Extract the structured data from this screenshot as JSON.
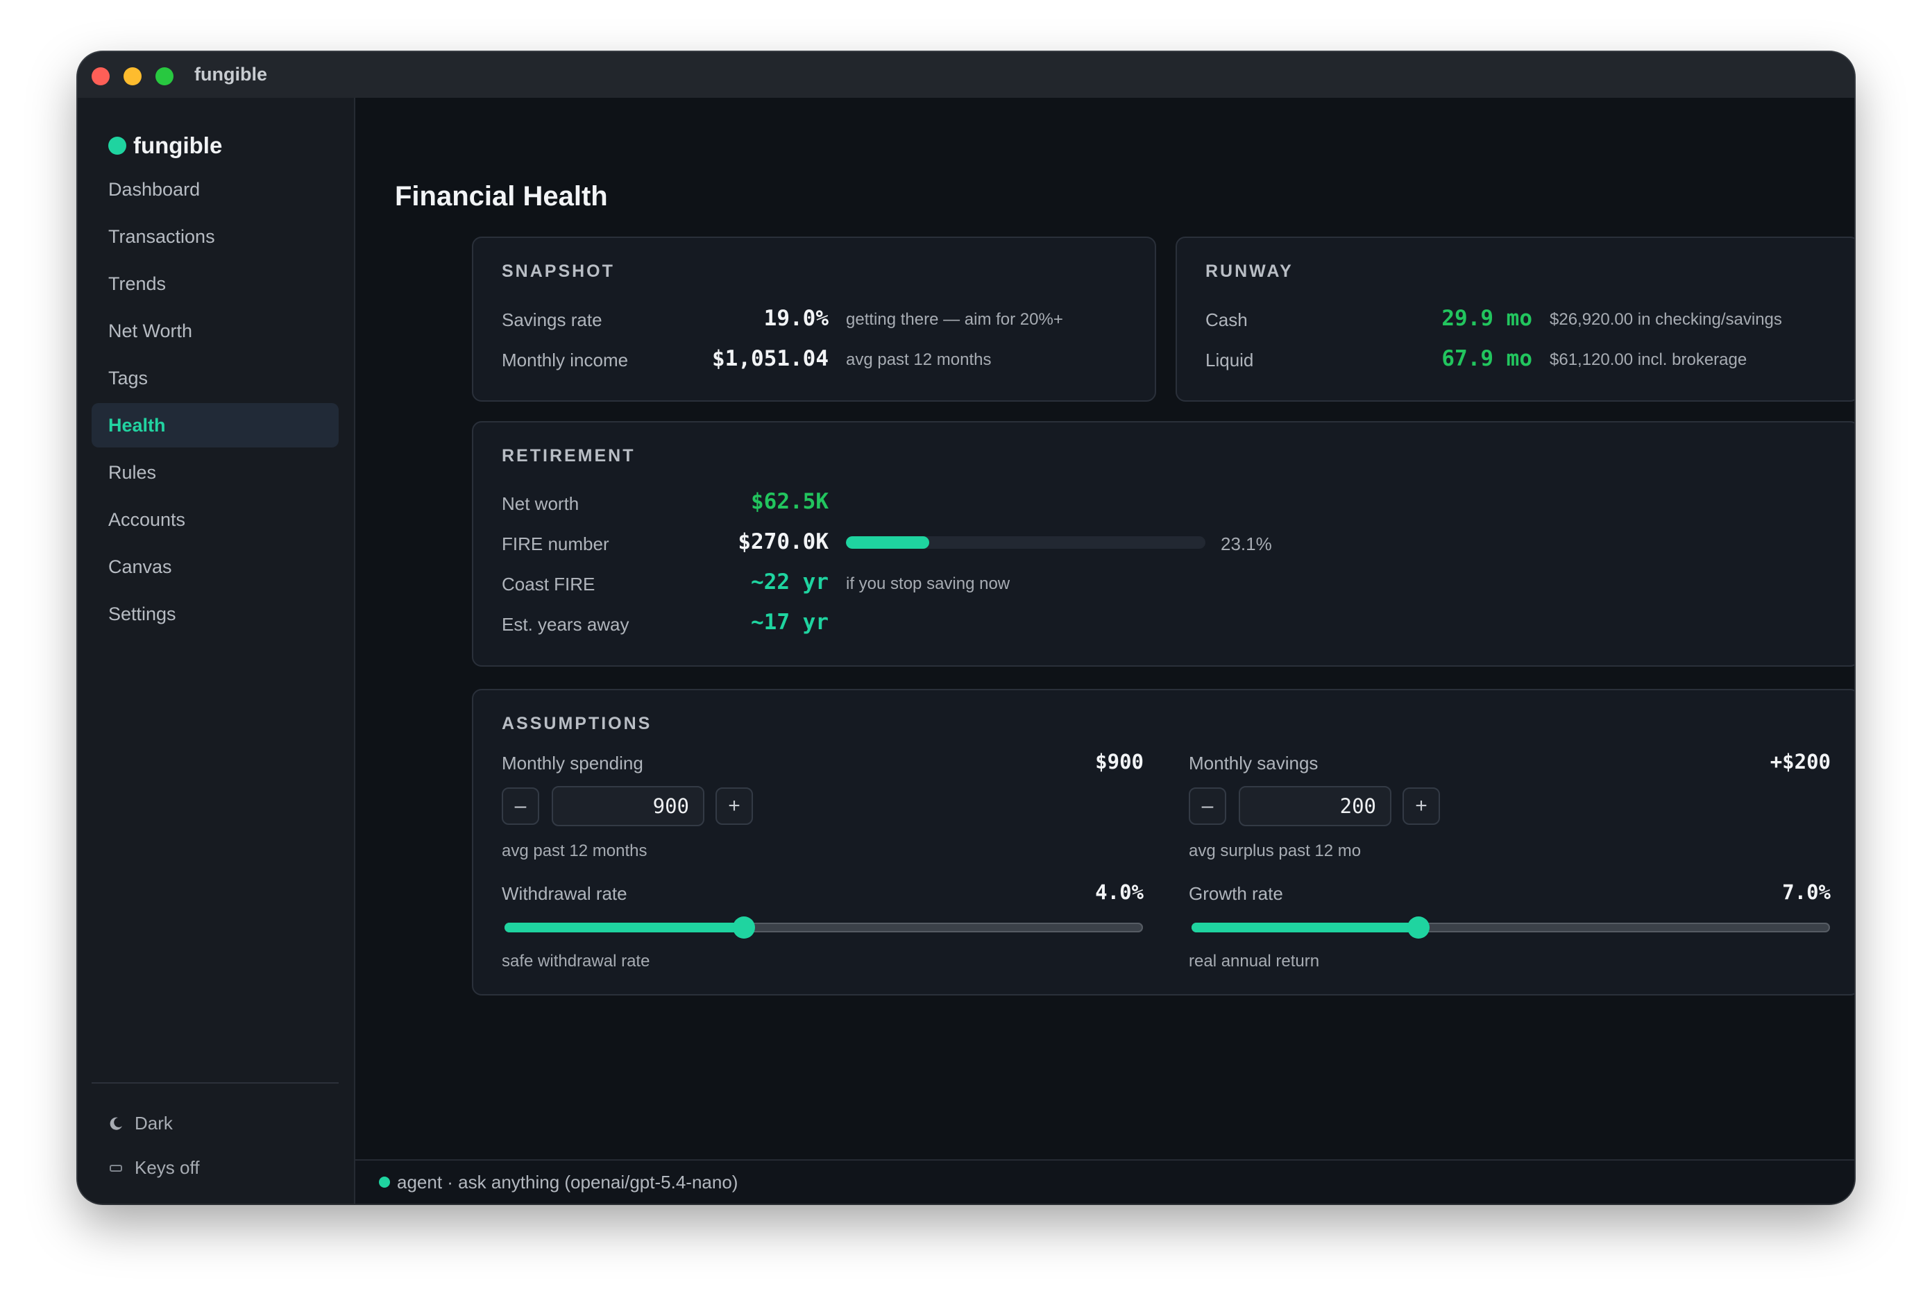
{
  "window": {
    "title": "fungible"
  },
  "sidebar": {
    "brand": "fungible",
    "items": [
      {
        "label": "Dashboard"
      },
      {
        "label": "Transactions"
      },
      {
        "label": "Trends"
      },
      {
        "label": "Net Worth"
      },
      {
        "label": "Tags"
      },
      {
        "label": "Health",
        "active": true
      },
      {
        "label": "Rules"
      },
      {
        "label": "Accounts"
      },
      {
        "label": "Canvas"
      },
      {
        "label": "Settings"
      }
    ],
    "theme_label": "Dark",
    "keys_label": "Keys off"
  },
  "page": {
    "title": "Financial Health"
  },
  "snapshot": {
    "label": "SNAPSHOT",
    "savings_rate": {
      "label": "Savings rate",
      "value": "19.0%",
      "note": "getting there — aim for 20%+"
    },
    "monthly_income": {
      "label": "Monthly income",
      "value": "$1,051.04",
      "note": "avg past 12 months"
    }
  },
  "runway": {
    "label": "RUNWAY",
    "cash": {
      "label": "Cash",
      "value": "29.9 mo",
      "note": "$26,920.00 in checking/savings"
    },
    "liquid": {
      "label": "Liquid",
      "value": "67.9 mo",
      "note": "$61,120.00 incl. brokerage"
    }
  },
  "retirement": {
    "label": "RETIREMENT",
    "net_worth": {
      "label": "Net worth",
      "value": "$62.5K"
    },
    "fire_number": {
      "label": "FIRE number",
      "value": "$270.0K",
      "progress_pct": 23.1,
      "progress_text": "23.1%"
    },
    "coast_fire": {
      "label": "Coast FIRE",
      "value": "~22 yr",
      "note": "if you stop saving now"
    },
    "years_away": {
      "label": "Est. years away",
      "value": "~17 yr"
    }
  },
  "assumptions": {
    "label": "ASSUMPTIONS",
    "monthly_spending": {
      "label": "Monthly spending",
      "display": "$900",
      "input": "900",
      "note": "avg past 12 months"
    },
    "monthly_savings": {
      "label": "Monthly savings",
      "display": "+$200",
      "input": "200",
      "note": "avg surplus past 12 mo"
    },
    "withdrawal_rate": {
      "label": "Withdrawal rate",
      "display": "4.0%",
      "level": 0.375,
      "note": "safe withdrawal rate"
    },
    "growth_rate": {
      "label": "Growth rate",
      "display": "7.0%",
      "level": 0.355,
      "note": "real annual return"
    }
  },
  "agent_bar": {
    "text": "agent · ask anything (openai/gpt-5.4-nano)"
  },
  "colors": {
    "accent": "#1fd4a0",
    "positive": "#22c55e",
    "background": "#0e1217",
    "card": "#151a22"
  }
}
